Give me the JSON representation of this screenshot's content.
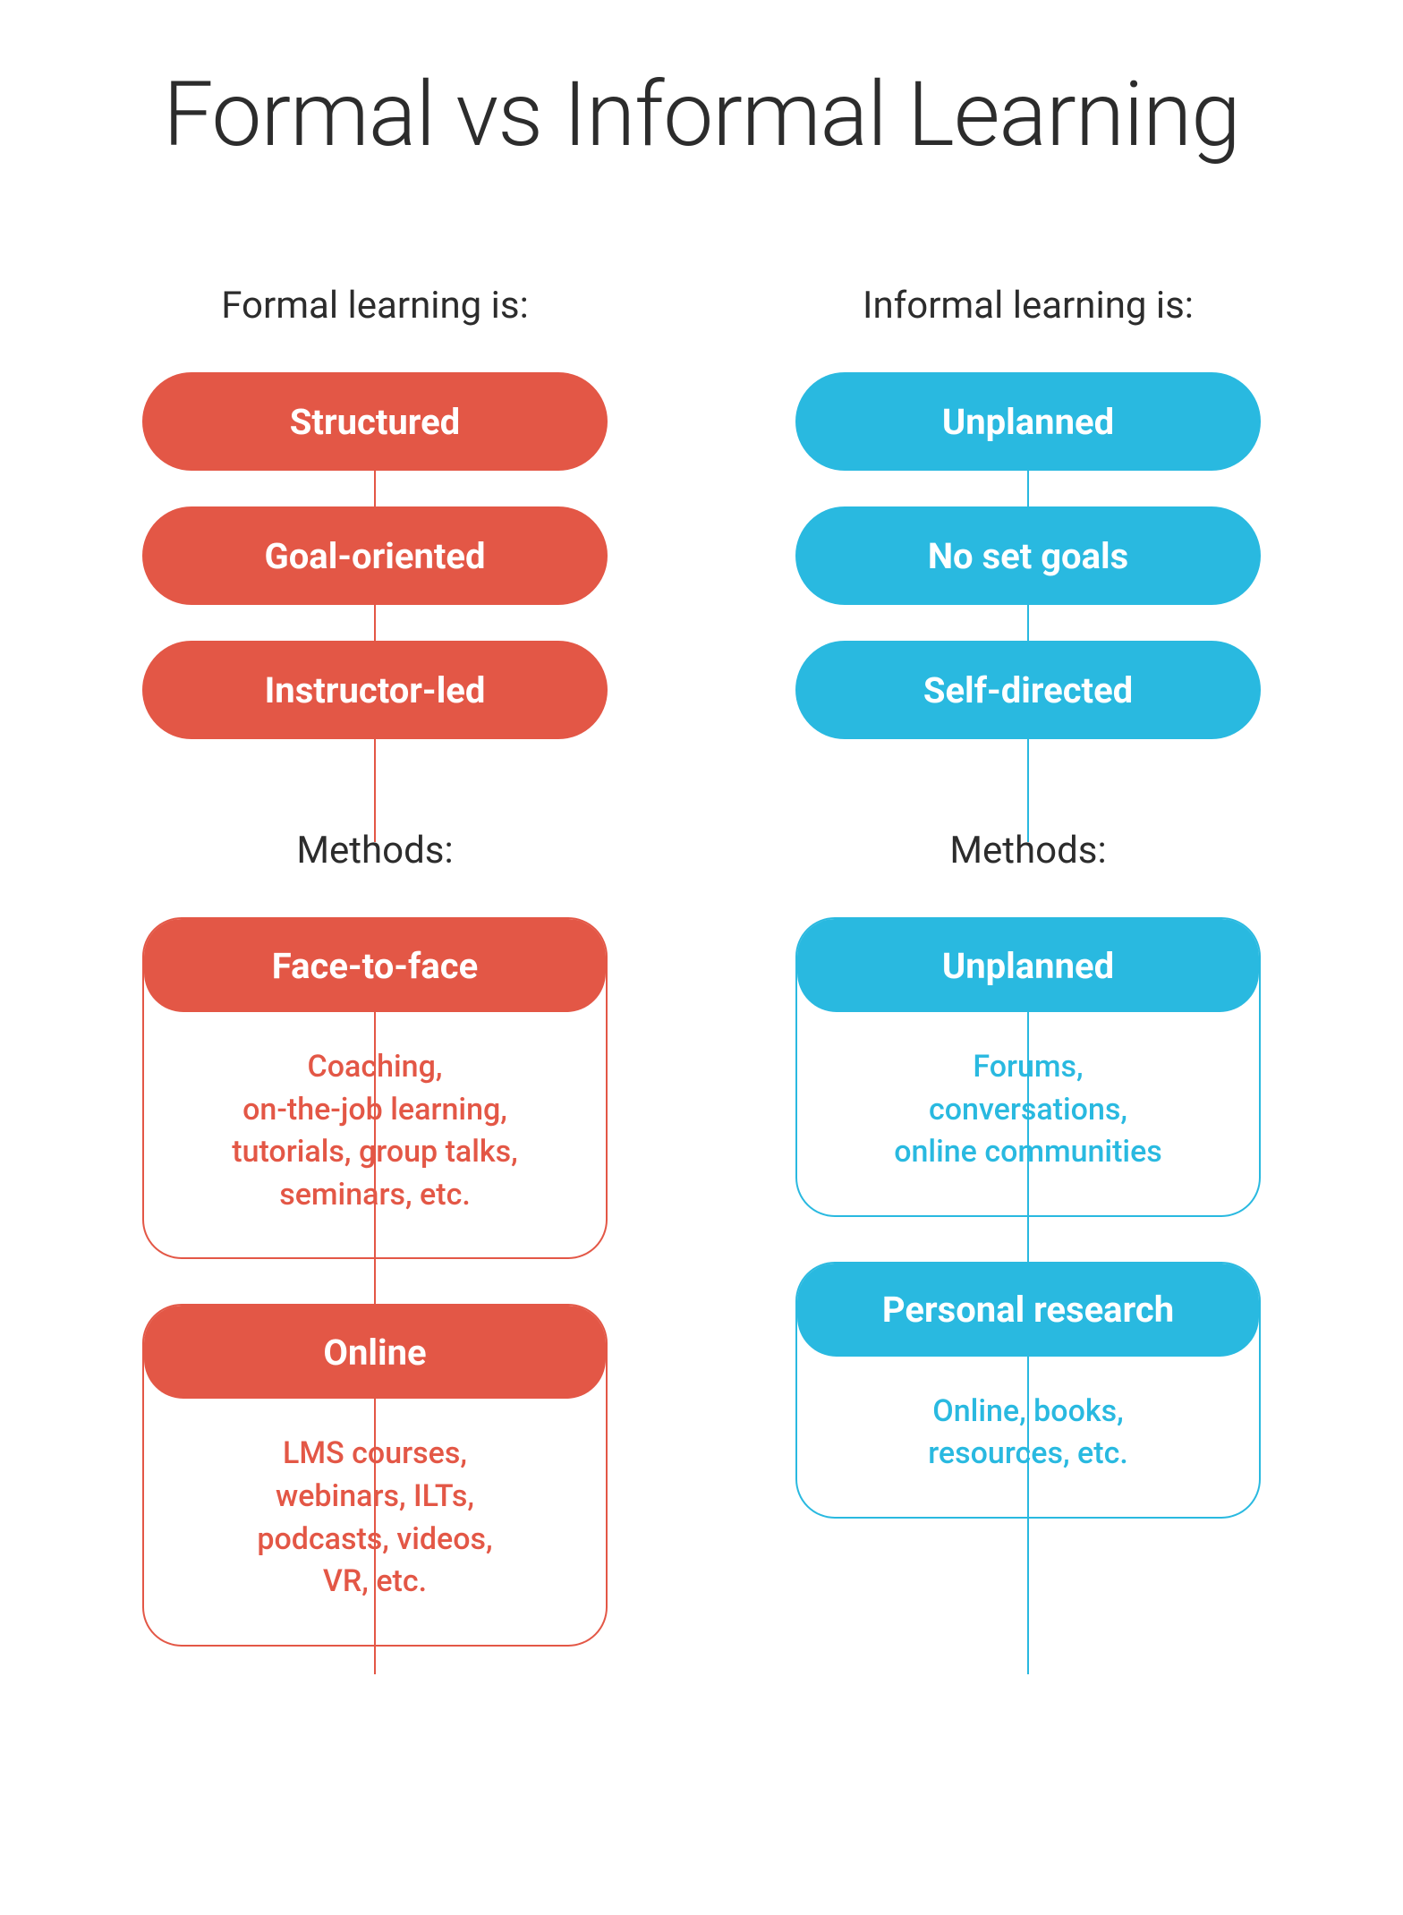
{
  "title": "Formal vs Informal Learning",
  "formal": {
    "heading": "Formal learning is:",
    "traits": [
      "Structured",
      "Goal-oriented",
      "Instructor-led"
    ],
    "methods_heading": "Methods:",
    "methods": [
      {
        "title": "Face-to-face",
        "body": "Coaching,\non-the-job learning,\ntutorials, group talks,\nseminars, etc."
      },
      {
        "title": "Online",
        "body": "LMS courses,\nwebinars, ILTs,\npodcasts, videos,\nVR, etc."
      }
    ]
  },
  "informal": {
    "heading": "Informal learning is:",
    "traits": [
      "Unplanned",
      "No set goals",
      "Self-directed"
    ],
    "methods_heading": "Methods:",
    "methods": [
      {
        "title": "Unplanned",
        "body": "Forums,\nconversations,\nonline communities"
      },
      {
        "title": "Personal research",
        "body": "Online, books,\nresources, etc."
      }
    ]
  },
  "colors": {
    "formal": "#e35746",
    "informal": "#29b9e0"
  }
}
